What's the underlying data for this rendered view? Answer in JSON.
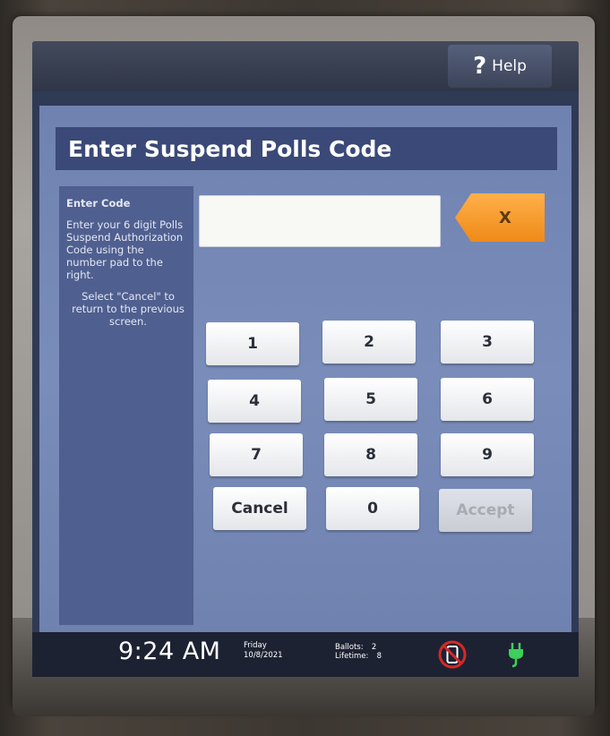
{
  "help": {
    "label": "Help",
    "icon": "question-mark-icon"
  },
  "page": {
    "title": "Enter Suspend Polls Code"
  },
  "instructions": {
    "heading": "Enter Code",
    "body": "Enter your 6 digit Polls Suspend Authorization Code using the number pad to the right.",
    "cancel_hint": "Select \"Cancel\" to return to the previous screen."
  },
  "code_input": {
    "value": ""
  },
  "clear_button": {
    "label": "X"
  },
  "keypad": {
    "k1": "1",
    "k2": "2",
    "k3": "3",
    "k4": "4",
    "k5": "5",
    "k6": "6",
    "k7": "7",
    "k8": "8",
    "k9": "9",
    "cancel": "Cancel",
    "k0": "0",
    "accept": "Accept"
  },
  "status": {
    "time": "9:24 AM",
    "day": "Friday",
    "date": "10/8/2021",
    "ballots_label": "Ballots:",
    "ballots_value": "2",
    "lifetime_label": "Lifetime:",
    "lifetime_value": "8"
  },
  "colors": {
    "accent_orange": "#ef8a18",
    "title_bar": "#3b4978",
    "panel_bg": "#7a8dba",
    "status_red": "#d62828",
    "status_green": "#3ecf5a"
  }
}
